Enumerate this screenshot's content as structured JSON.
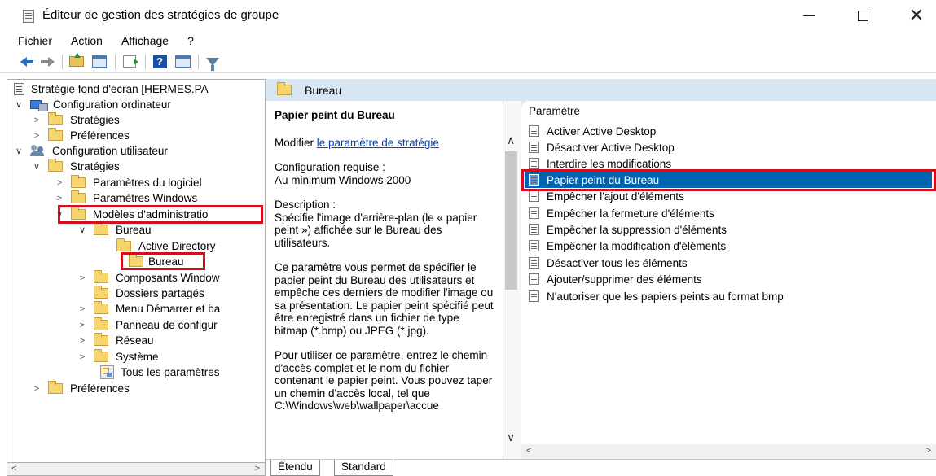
{
  "window": {
    "title": "Éditeur de gestion des stratégies de groupe",
    "min_glyph": "",
    "close_glyph": "✕"
  },
  "menu": [
    "Fichier",
    "Action",
    "Affichage",
    "?"
  ],
  "toolbar": {
    "icons": [
      "back-arrow-icon",
      "forward-arrow-icon",
      "folder-up-icon",
      "show-hide-pane-icon",
      "export-list-icon",
      "help-icon",
      "view-icon",
      "filter-icon"
    ],
    "help_glyph": "?"
  },
  "tree": {
    "root": "Stratégie fond d'ecran [HERMES.PA",
    "computer_config": "Configuration ordinateur",
    "cc_strategies": "Stratégies",
    "cc_preferences": "Préférences",
    "user_config": "Configuration utilisateur",
    "uc_strategies": "Stratégies",
    "software_settings": "Paramètres du logiciel",
    "windows_settings": "Paramètres Windows",
    "admin_templates": "Modèles d'administratio",
    "bureau": "Bureau",
    "active_directory": "Active Directory",
    "bureau_sub": "Bureau",
    "win_components": "Composants Window",
    "shared_folders": "Dossiers partagés",
    "start_menu": "Menu Démarrer et ba",
    "control_panel": "Panneau de configur",
    "network": "Réseau",
    "system": "Système",
    "all_settings": "Tous les paramètres",
    "uc_preferences": "Préférences"
  },
  "header": {
    "folder_title": "Bureau"
  },
  "description": {
    "title": "Papier peint du Bureau",
    "modify_prefix": "Modifier ",
    "modify_link": "le paramètre de stratégie",
    "requirements_label": "Configuration requise :",
    "requirements_value": "Au minimum Windows 2000",
    "description_label": "Description :",
    "description_text": "Spécifie l'image d'arrière-plan (le « papier peint ») affichée sur le Bureau des utilisateurs.",
    "para2": "Ce paramètre vous permet de spécifier le papier peint du Bureau des utilisateurs et empêche ces derniers de modifier l'image ou sa présentation. Le papier peint spécifié peut être enregistré dans un fichier de type bitmap (*.bmp) ou JPEG (*.jpg).",
    "para3": "Pour utiliser ce paramètre, entrez le chemin d'accès complet et le nom du fichier contenant le papier peint. Vous pouvez taper un chemin d'accès local, tel que C:\\Windows\\web\\wallpaper\\accue"
  },
  "settings_list": {
    "column_header": "Paramètre",
    "items": [
      "Activer Active Desktop",
      "Désactiver Active Desktop",
      "Interdire les modifications",
      "Papier peint du Bureau",
      "Empêcher l'ajout d'éléments",
      "Empêcher la fermeture d'éléments",
      "Empêcher la suppression d'éléments",
      "Empêcher la modification d'éléments",
      "Désactiver tous les éléments",
      "Ajouter/supprimer des éléments",
      "N'autoriser que les papiers peints au format bmp"
    ],
    "selected_index": 3
  },
  "tabs": [
    "Étendu",
    "Standard"
  ],
  "colors": {
    "selection": "#0063b1",
    "highlight_box": "#d10f1f",
    "header_band": "#d8e6f3",
    "link": "#0645ad"
  }
}
